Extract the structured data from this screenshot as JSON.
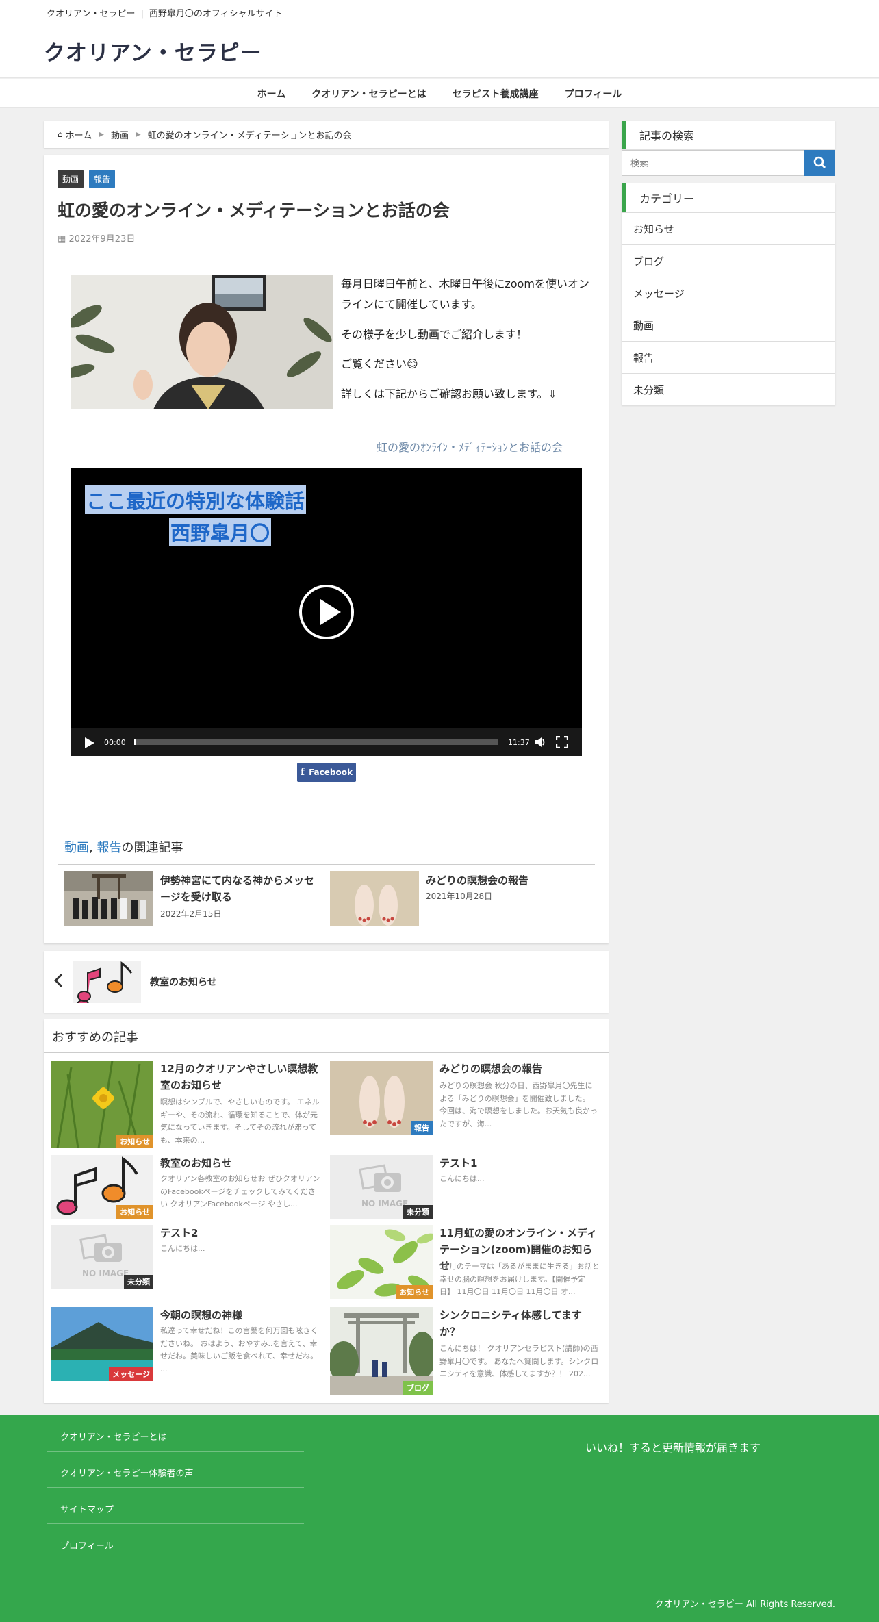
{
  "header": {
    "site_name_small": "クオリアン・セラピー",
    "tagline": "西野皐月〇のオフィシャルサイト",
    "site_title": "クオリアン・セラピー"
  },
  "nav": [
    "ホーム",
    "クオリアン・セラピーとは",
    "セラピスト養成講座",
    "プロフィール"
  ],
  "breadcrumb": [
    "ホーム",
    "動画",
    "虹の愛のオンライン・メディテーションとお話の会"
  ],
  "article": {
    "tags": [
      "動画",
      "報告"
    ],
    "title": "虹の愛のオンライン・メディテーションとお話の会",
    "date": "2022年9月23日",
    "paragraphs": [
      "毎月日曜日午前と、木曜日午後にzoomを使いオンラインにて開催しています。",
      "その様子を少し動画でご紹介します！",
      "ご覧ください😊",
      "詳しくは下記からご確認お願い致します。⇩"
    ],
    "link_text": "虹の愛のｵﾝﾗｲﾝ・ﾒﾃﾞｨﾃｰｼｮﾝとお話の会",
    "video": {
      "caption1": "ここ最近の特別な体験話",
      "caption2": "西野皐月〇",
      "time_current": "00:00",
      "time_total": "11:37"
    },
    "facebook_label": "Facebook"
  },
  "related": {
    "head_link1": "動画",
    "head_sep": ", ",
    "head_link2": "報告",
    "head_suffix": "の関連記事",
    "items": [
      {
        "title": "伊勢神宮にて内なる神からメッセージを受け取る",
        "date": "2022年2月15日"
      },
      {
        "title": "みどりの瞑想会の報告",
        "date": "2021年10月28日"
      }
    ]
  },
  "prev_post": {
    "title": "教室のお知らせ"
  },
  "recommend": {
    "head": "おすすめの記事",
    "items": [
      {
        "title": "12月のクオリアンやさしい瞑想教室のお知らせ",
        "excerpt": "瞑想はシンプルで、やさしいものです。 エネルギーや、その流れ、循環を知ることで、体が元気になっていきます。そしてその流れが滞っても、本来の...",
        "badge": "お知らせ"
      },
      {
        "title": "みどりの瞑想会の報告",
        "excerpt": "みどりの瞑想会 秋分の日、西野皐月〇先生による「みどりの瞑想会」を開催致しました。 今回は、海で瞑想をしました。お天気も良かったですが、海...",
        "badge": "報告"
      },
      {
        "title": "教室のお知らせ",
        "excerpt": "クオリアン各教室のお知らせお ぜひクオリアンのFacebookページをチェックしてみてください クオリアンFacebookページ やさし...",
        "badge": "お知らせ"
      },
      {
        "title": "テスト1",
        "excerpt": "こんにちは...",
        "badge": "未分類"
      },
      {
        "title": "テスト2",
        "excerpt": "こんにちは...",
        "badge": "未分類"
      },
      {
        "title": "11月虹の愛のオンライン・メディテーション(zoom)開催のお知らせ",
        "excerpt": "11月のテーマは「あるがままに生きる」お話と幸せの脳の瞑想をお届けします。【開催予定日】 11月〇日 11月〇日 11月〇日 オ...",
        "badge": "お知らせ"
      },
      {
        "title": "今朝の瞑想の神様",
        "excerpt": "私達って幸せだね！この言葉を何万回も呟きくださいね。 おはよう、おやすみ..を言えて、幸せだね。美味しいご飯を食べれて、幸せだね。 ...",
        "badge": "メッセージ"
      },
      {
        "title": "シンクロニシティ体感してますか？",
        "excerpt": "こんにちは！ クオリアンセラピスト(講師)の西野皐月〇です。 あなたへ質問します。シンクロニシティを意識、体感してますか？！ 202...",
        "badge": "ブログ"
      }
    ],
    "noimage_label": "NO IMAGE"
  },
  "sidebar": {
    "search_head": "記事の検索",
    "search_placeholder": "検索",
    "category_head": "カテゴリー",
    "categories": [
      "お知らせ",
      "ブログ",
      "メッセージ",
      "動画",
      "報告",
      "未分類"
    ]
  },
  "footer": {
    "links": [
      "クオリアン・セラピーとは",
      "クオリアン・セラピー体験者の声",
      "サイトマップ",
      "プロフィール"
    ],
    "like_text": "いいね！すると更新情報が届きます",
    "copyright": "クオリアン・セラピー All Rights Reserved."
  },
  "colors": {
    "accent_green": "#3aa54b",
    "footer_green": "#34a74c",
    "link_blue": "#2e7bbf",
    "badge_orange": "#e0932b",
    "badge_dark": "#333333",
    "badge_red": "#d9393b",
    "badge_lime": "#7fc24a",
    "facebook_blue": "#3b5998"
  }
}
